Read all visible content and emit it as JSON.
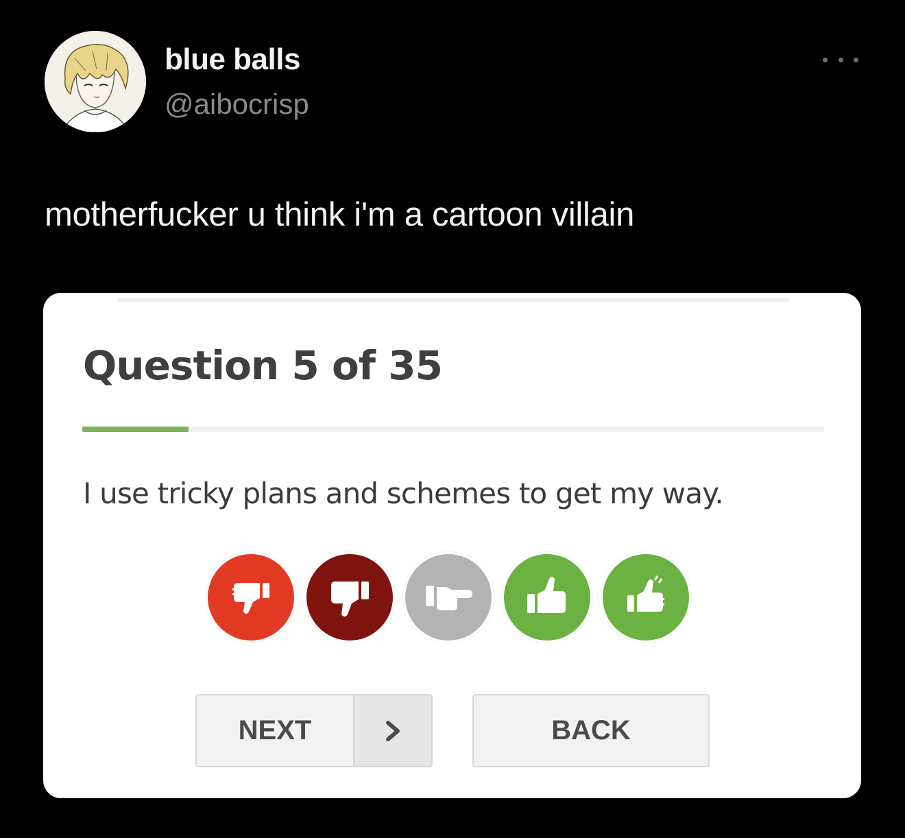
{
  "post": {
    "author": {
      "display_name": "blue balls",
      "handle": "@aibocrisp"
    },
    "text": "motherfucker u think i'm a cartoon villain",
    "menu_icon": "more-horizontal-icon"
  },
  "quiz": {
    "counter": "Question 5 of 35",
    "progress": 0.143,
    "progress_color": "#7fb55a",
    "question": "I use tricky plans and schemes to get my way.",
    "answers": [
      {
        "icon": "double-thumbs-down-icon",
        "color": "#e23a24"
      },
      {
        "icon": "thumbs-down-icon",
        "color": "#7e140d"
      },
      {
        "icon": "pointing-sideways-icon",
        "color": "#b3b3b3"
      },
      {
        "icon": "thumbs-up-icon",
        "color": "#6cb243"
      },
      {
        "icon": "double-thumbs-up-icon",
        "color": "#6cb243"
      }
    ],
    "next_label": "NEXT",
    "next_arrow_icon": "chevron-right-icon",
    "back_label": "BACK"
  }
}
